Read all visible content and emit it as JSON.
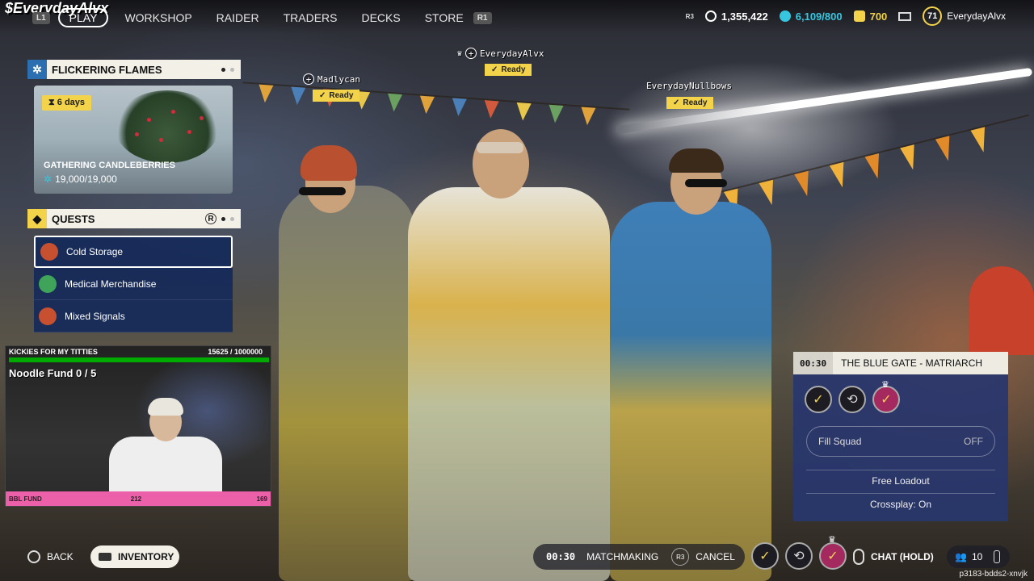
{
  "overlay": {
    "streamer_name": "$EverydayAlvx"
  },
  "nav": {
    "left_trigger": "L1",
    "play": "PLAY",
    "items": [
      "WORKSHOP",
      "RAIDER",
      "TRADERS",
      "DECKS",
      "STORE"
    ],
    "right_trigger": "R1"
  },
  "stats": {
    "r3": "R3",
    "coins": "1,355,422",
    "currency": "6,109/800",
    "tokens": "700",
    "level": "71",
    "username": "EverydayAlvx",
    "colors": {
      "coins": "#ffffff",
      "currency": "#37c6e0",
      "tokens": "#f2d34a"
    }
  },
  "event": {
    "title": "FLICKERING FLAMES",
    "days": "6 days",
    "card_title": "GATHERING CANDLEBERRIES",
    "progress": "19,000/19,000"
  },
  "quests": {
    "title": "QUESTS",
    "items": [
      {
        "label": "Cold Storage",
        "color": "#c6502f"
      },
      {
        "label": "Medical Merchandise",
        "color": "#3fa45a"
      },
      {
        "label": "Mixed Signals",
        "color": "#c6502f"
      }
    ]
  },
  "webcam": {
    "header_left": "KICKIES FOR MY TITTIES",
    "header_right": "15625 / 1000000",
    "fund": "Noodle Fund 0 / 5",
    "bottom_left": "BBL FUND",
    "bottom_mid": "212",
    "bottom_right": "169"
  },
  "players": [
    {
      "name": "Madlycan",
      "status": "Ready"
    },
    {
      "name": "EverydayAlvx",
      "status": "Ready"
    },
    {
      "name": "EverydayNullbows",
      "status": "Ready"
    }
  ],
  "mission": {
    "timer": "00:30",
    "name": "THE BLUE GATE - MATRIARCH",
    "fill_squad_label": "Fill Squad",
    "fill_squad_value": "OFF",
    "free_loadout": "Free Loadout",
    "crossplay": "Crossplay: On"
  },
  "bottom": {
    "back": "BACK",
    "inventory": "INVENTORY",
    "timer": "00:30",
    "matchmaking": "MATCHMAKING",
    "r3": "R3",
    "cancel": "CANCEL",
    "chat": "CHAT (HOLD)",
    "party_count": "10",
    "session_code": "p3183-bdds2-xnvjk"
  }
}
